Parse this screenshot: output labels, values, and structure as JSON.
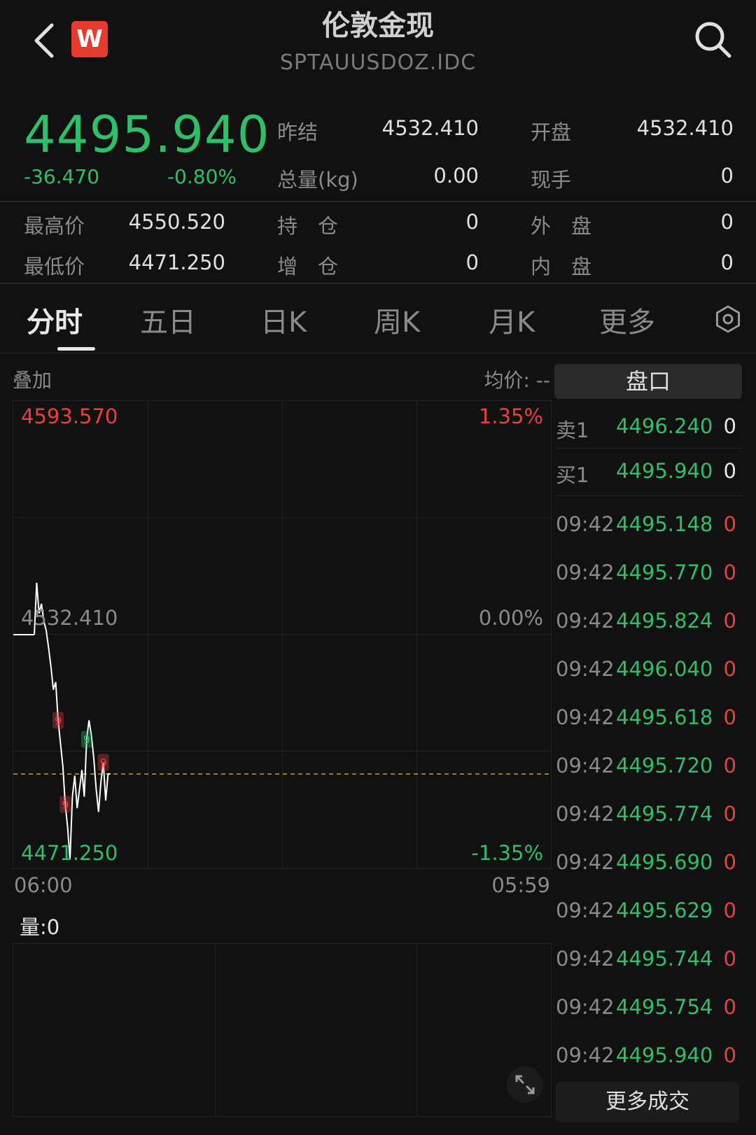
{
  "header": {
    "title": "伦敦金现",
    "code": "SPTAUUSDOZ.IDC",
    "logo_letter": "W"
  },
  "quote": {
    "price": "4495.940",
    "change": "-36.470",
    "change_pct": "-0.80%",
    "stats": [
      {
        "label": "昨结",
        "value": "4532.410"
      },
      {
        "label": "开盘",
        "value": "4532.410"
      },
      {
        "label": "总量(kg)",
        "value": "0.00"
      },
      {
        "label": "现手",
        "value": "0"
      },
      {
        "label": "最高价",
        "value": "4550.520"
      },
      {
        "label": "持　仓",
        "value": "0"
      },
      {
        "label": "外　盘",
        "value": "0"
      },
      {
        "label": "最低价",
        "value": "4471.250"
      },
      {
        "label": "增　仓",
        "value": "0"
      },
      {
        "label": "内　盘",
        "value": "0"
      }
    ]
  },
  "tabs": [
    "分时",
    "五日",
    "日K",
    "周K",
    "月K",
    "更多"
  ],
  "chart": {
    "overlay_label": "叠加",
    "avg_label": "均价: --",
    "y_top": "4593.570",
    "y_top_pct": "1.35%",
    "y_mid": "4532.410",
    "y_mid_pct": "0.00%",
    "y_bottom": "4471.250",
    "y_bottom_pct": "-1.35%",
    "x_start": "06:00",
    "x_end": "05:59",
    "volume_label": "量:0",
    "marker_label": "9"
  },
  "chart_data": {
    "type": "line",
    "title": "",
    "x": [
      0,
      1,
      2,
      3,
      4,
      5,
      6,
      7,
      8,
      9,
      10,
      11,
      12,
      13,
      14,
      15,
      16,
      17,
      18,
      19,
      20,
      21,
      22,
      23,
      24,
      25,
      26,
      27,
      28,
      29,
      30,
      31,
      32
    ],
    "series": [
      {
        "values": [
          4532.41,
          4546.0,
          4538.0,
          4540.5,
          4536.0,
          4533.5,
          4529.0,
          4524.0,
          4518.0,
          4520.0,
          4510.0,
          4504.0,
          4498.0,
          4488.0,
          4482.0,
          4473.5,
          4490.0,
          4495.5,
          4487.0,
          4492.0,
          4497.0,
          4490.0,
          4505.0,
          4510.0,
          4506.0,
          4500.0,
          4492.0,
          4486.0,
          4494.0,
          4499.0,
          4489.0,
          4496.0,
          4495.94
        ]
      }
    ],
    "reference_line": 4532.41,
    "current_line": 4495.94,
    "ylim": [
      4471.25,
      4593.57
    ],
    "xlabels": [
      "06:00",
      "05:59"
    ],
    "grid": true
  },
  "orderbook": {
    "title": "盘口",
    "rows": [
      {
        "side": "卖1",
        "price": "4496.240",
        "vol": "0"
      },
      {
        "side": "买1",
        "price": "4495.940",
        "vol": "0"
      }
    ]
  },
  "trades": [
    {
      "time": "09:42",
      "price": "4495.148",
      "vol": "0"
    },
    {
      "time": "09:42",
      "price": "4495.770",
      "vol": "0"
    },
    {
      "time": "09:42",
      "price": "4495.824",
      "vol": "0"
    },
    {
      "time": "09:42",
      "price": "4496.040",
      "vol": "0"
    },
    {
      "time": "09:42",
      "price": "4495.618",
      "vol": "0"
    },
    {
      "time": "09:42",
      "price": "4495.720",
      "vol": "0"
    },
    {
      "time": "09:42",
      "price": "4495.774",
      "vol": "0"
    },
    {
      "time": "09:42",
      "price": "4495.690",
      "vol": "0"
    },
    {
      "time": "09:42",
      "price": "4495.629",
      "vol": "0"
    },
    {
      "time": "09:42",
      "price": "4495.744",
      "vol": "0"
    },
    {
      "time": "09:42",
      "price": "4495.754",
      "vol": "0"
    },
    {
      "time": "09:42",
      "price": "4495.940",
      "vol": "0"
    }
  ],
  "more_trades_label": "更多成交",
  "colors": {
    "up": "#e8413f",
    "down": "#2ebf6a",
    "bg": "#111111",
    "line": "#ffffff",
    "dash": "#c9a227"
  }
}
